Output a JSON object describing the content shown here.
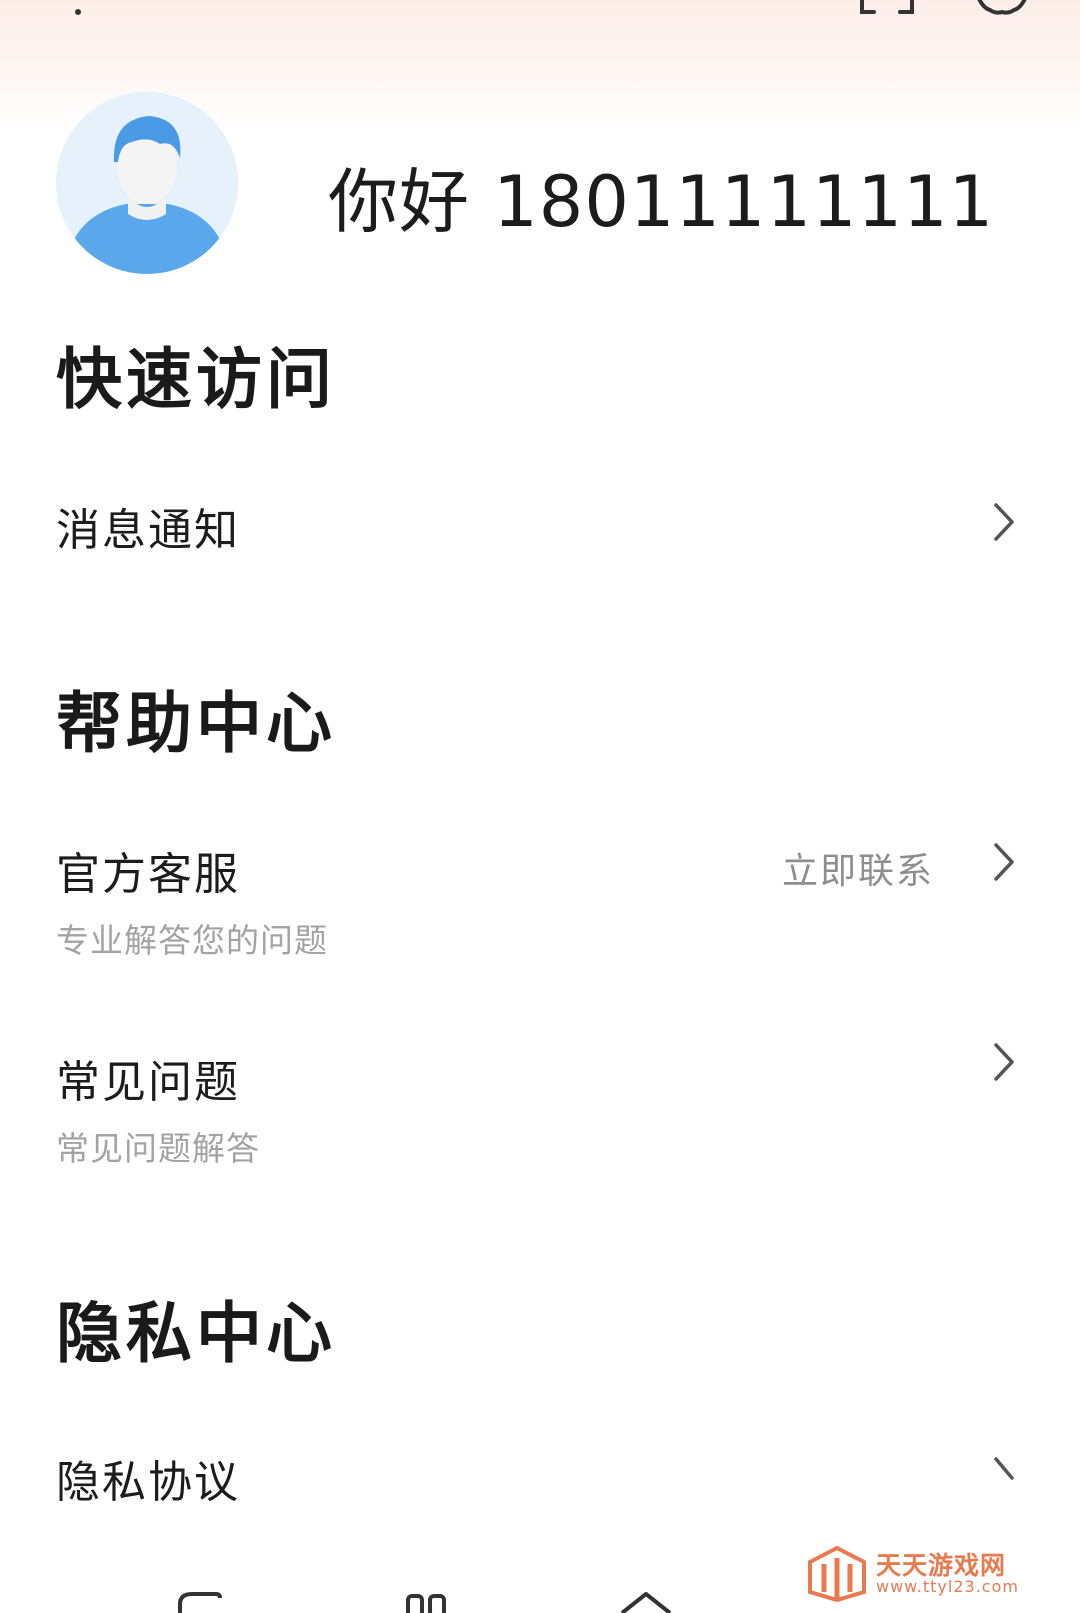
{
  "profile": {
    "greeting": "你好 18011111111"
  },
  "quick_access": {
    "title": "快速访问",
    "items": [
      {
        "label": "消息通知"
      }
    ]
  },
  "help_center": {
    "title": "帮助中心",
    "items": [
      {
        "label": "官方客服",
        "subtitle": "专业解答您的问题",
        "action": "立即联系"
      },
      {
        "label": "常见问题",
        "subtitle": "常见问题解答"
      }
    ]
  },
  "privacy_center": {
    "title": "隐私中心",
    "items": [
      {
        "label": "隐私协议"
      }
    ]
  },
  "watermark": {
    "title": "天天游戏网",
    "url": "www.ttyl23.com"
  },
  "icons": {
    "top_left": "headset-icon",
    "top_right_1": "scan-icon",
    "top_right_2": "settings-icon",
    "chevron": "chevron-right-icon"
  },
  "colors": {
    "header_tint": "#fdeee9",
    "avatar_blue": "#5aa7ec",
    "watermark_orange": "#e97a4e"
  }
}
